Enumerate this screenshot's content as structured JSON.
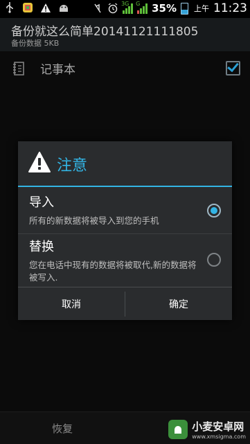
{
  "status_bar": {
    "battery_percent": "35%",
    "ampm": "上午",
    "time": "11:23",
    "network1": "3G",
    "network2": "G",
    "icons": [
      "usb-icon",
      "app-notification-icon",
      "warning-icon",
      "android-icon",
      "mute-icon",
      "alarm-icon",
      "signal-icon",
      "battery-icon"
    ]
  },
  "app": {
    "title": "备份就这么简单20141121111805",
    "subtitle": "备份数据 5KB",
    "notes_label": "记事本",
    "restore_label": "恢复"
  },
  "dialog": {
    "title": "注意",
    "options": [
      {
        "title": "导入",
        "description": "所有的新数据将被导入到您的手机",
        "selected": true
      },
      {
        "title": "替换",
        "description": "您在电话中现有的数据将被取代,新的数据将被写入.",
        "selected": false
      }
    ],
    "cancel_label": "取消",
    "ok_label": "确定"
  },
  "watermark": {
    "title": "小麦安卓网",
    "url": "www.xmsigma.com"
  },
  "colors": {
    "accent": "#33b5e5",
    "dialog_bg": "#2a2c2e",
    "signal": "#5fbf3a"
  }
}
